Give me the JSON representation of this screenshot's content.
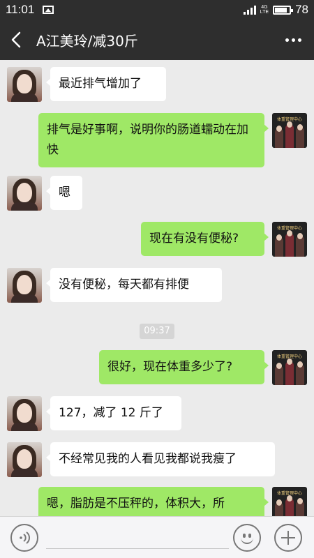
{
  "status_bar": {
    "time": "11:01",
    "network_top": "4G",
    "network_bottom": "LTE",
    "battery_percent": "78"
  },
  "header": {
    "title": "A江美玲/减30斤"
  },
  "messages": [
    {
      "side": "left",
      "text": "最近排气增加了"
    },
    {
      "side": "right",
      "text": "排气是好事啊，说明你的肠道蠕动在加快"
    },
    {
      "side": "left",
      "text": "嗯"
    },
    {
      "side": "right",
      "text": "现在有没有便秘?"
    },
    {
      "side": "left",
      "text": "没有便秘，每天都有排便"
    },
    {
      "side": "right",
      "text": "很好，现在体重多少了?"
    },
    {
      "side": "left",
      "text": "127，减了 12 斤了"
    },
    {
      "side": "left",
      "text": "不经常见我的人看见我都说我瘦了"
    },
    {
      "side": "right",
      "text": "嗯，脂肪是不压秤的，体积大，所"
    }
  ],
  "timestamp": "09:37",
  "brand_avatar_text": "体重管理中心",
  "input_bar": {
    "icons": [
      "voice-icon",
      "emoji-icon",
      "plus-icon"
    ]
  }
}
